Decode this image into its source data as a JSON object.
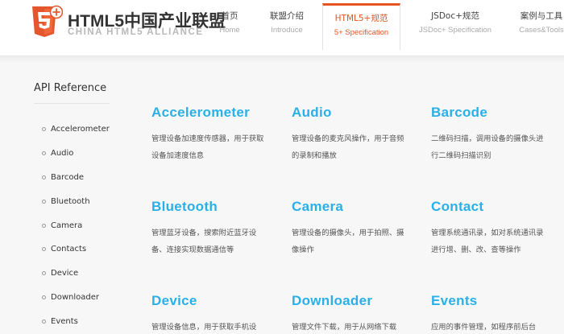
{
  "header": {
    "logo": {
      "badge": "5",
      "shield_number": "5",
      "title": "HTML5中国产业联盟",
      "subtitle": "CHINA HTML5 ALLIANCE"
    },
    "nav": [
      {
        "cn": "首页",
        "en": "Home",
        "active": false
      },
      {
        "cn": "联盟介绍",
        "en": "Introduce",
        "active": false
      },
      {
        "cn": "HTML5+规范",
        "en": "5+ Specification",
        "active": true
      },
      {
        "cn": "JSDoc+规范",
        "en": "JSDoc+ Specification",
        "active": false
      },
      {
        "cn": "案例与工具",
        "en": "Cases&Tools",
        "active": false
      }
    ],
    "accent_color": "#e8541e"
  },
  "sidebar": {
    "title": "API Reference",
    "items": [
      "Accelerometer",
      "Audio",
      "Barcode",
      "Bluetooth",
      "Camera",
      "Contacts",
      "Device",
      "Downloader",
      "Events"
    ]
  },
  "cards": [
    {
      "title": "Accelerometer",
      "desc": "管理设备加速度传感器，用于获取设备加速度信息"
    },
    {
      "title": "Audio",
      "desc": "管理设备的麦克风操作，用于音频的录制和播放"
    },
    {
      "title": "Barcode",
      "desc": "二维码扫描，调用设备的摄像头进行二维码扫描识别"
    },
    {
      "title": "Bluetooth",
      "desc": "管理蓝牙设备，搜索附近蓝牙设备、连接实现数据通信等"
    },
    {
      "title": "Camera",
      "desc": "管理设备的摄像头，用于拍照、摄像操作"
    },
    {
      "title": "Contact",
      "desc": "管理系统通讯录，如对系统通讯录进行增、删、改、查等操作"
    },
    {
      "title": "Device",
      "desc": "管理设备信息，用于获取手机设"
    },
    {
      "title": "Downloader",
      "desc": "管理文件下载，用于从网络下载"
    },
    {
      "title": "Events",
      "desc": "应用的事件管理，如程序前后台"
    }
  ],
  "colors": {
    "card_title": "#2ab0e8",
    "background": "#f7f7f7"
  }
}
